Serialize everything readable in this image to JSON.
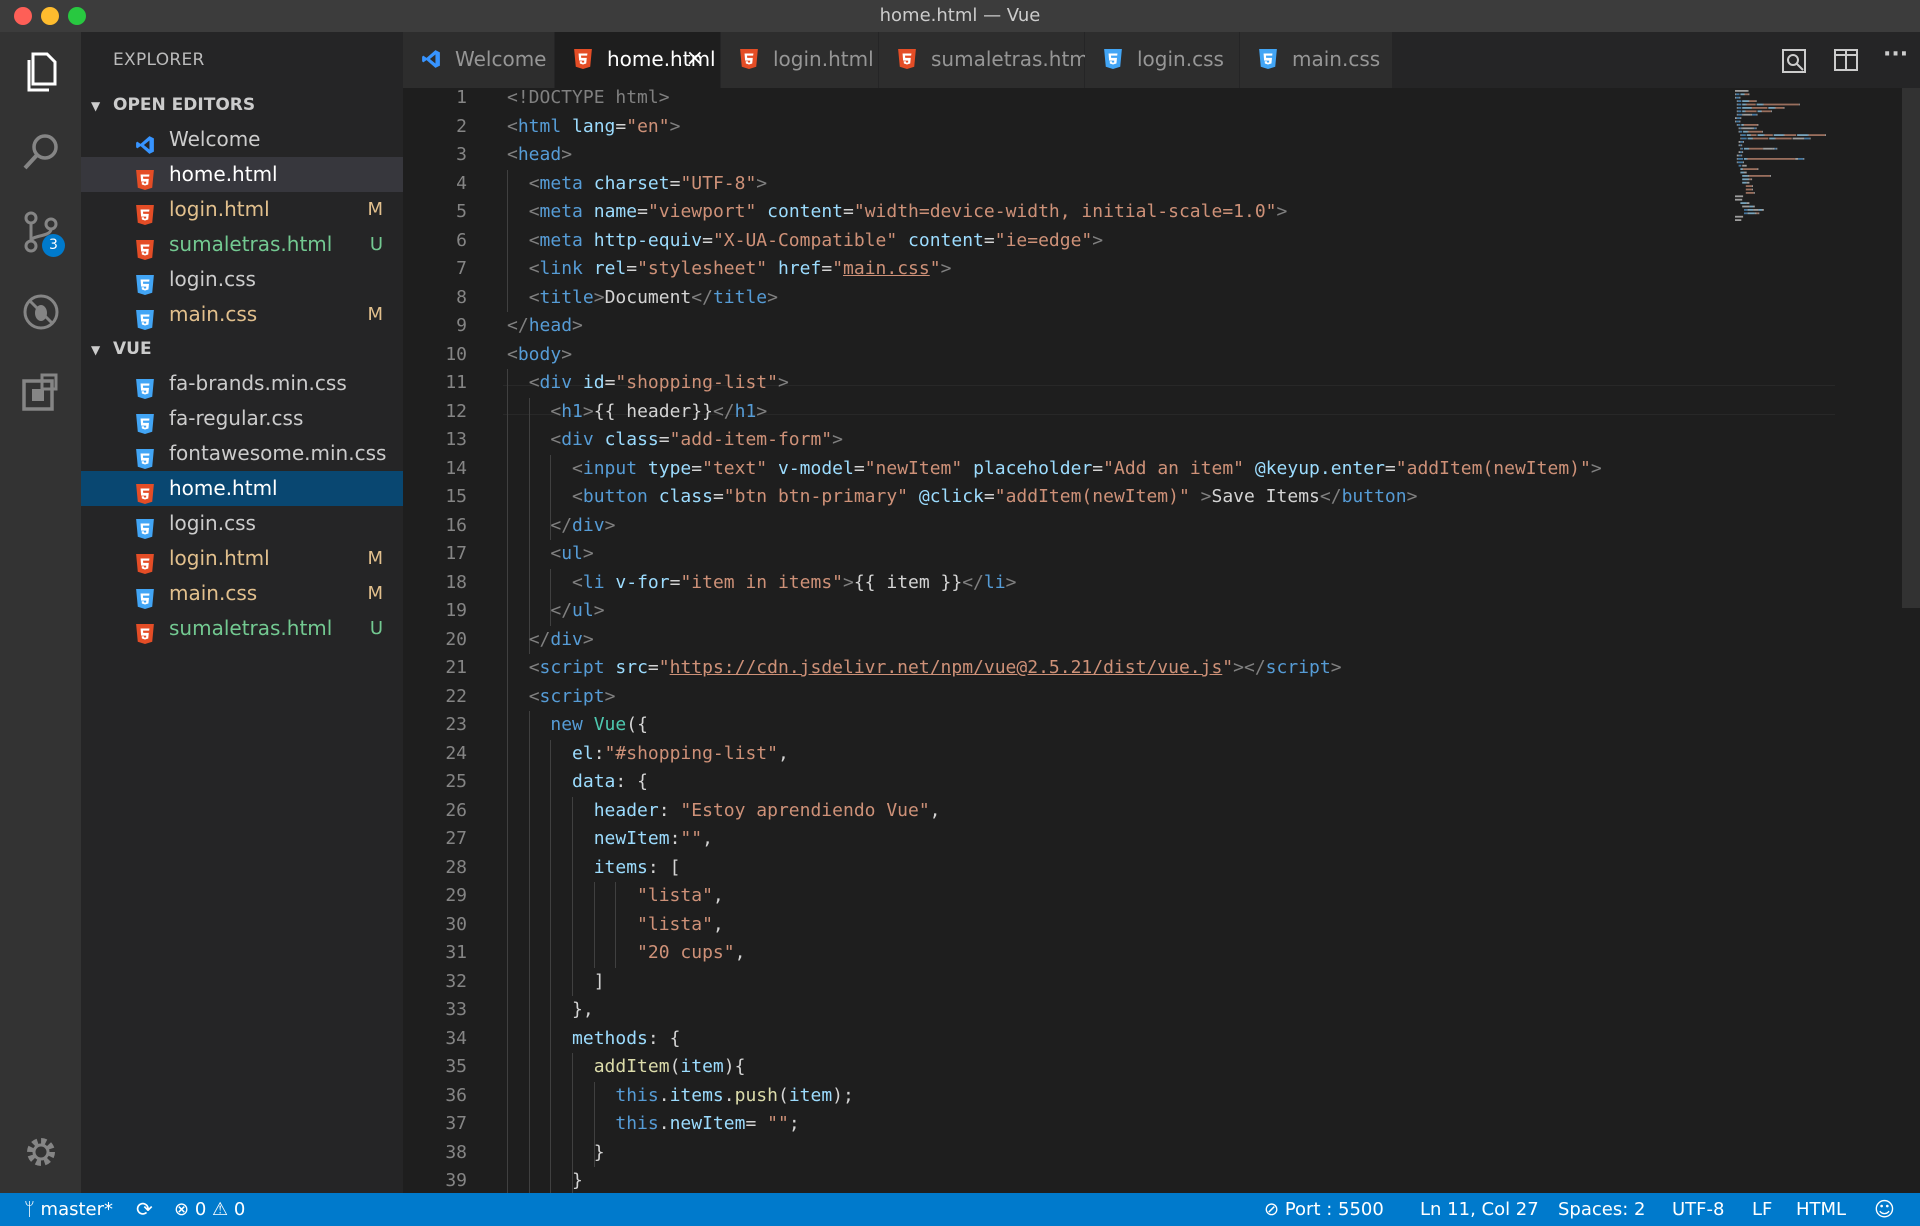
{
  "window": {
    "title": "home.html — Vue"
  },
  "activity": {
    "scm_badge": "3"
  },
  "sidebar": {
    "title": "EXPLORER",
    "open_editors_title": "OPEN EDITORS",
    "open_editors": [
      {
        "name": "Welcome",
        "type": "vscode",
        "status": "",
        "color": "#cccccc"
      },
      {
        "name": "home.html",
        "type": "html",
        "status": "",
        "color": "#ffffff"
      },
      {
        "name": "login.html",
        "type": "html",
        "status": "M",
        "color": "#e2c08d"
      },
      {
        "name": "sumaletras.html",
        "type": "html",
        "status": "U",
        "color": "#73c991"
      },
      {
        "name": "login.css",
        "type": "css",
        "status": "",
        "color": "#cccccc"
      },
      {
        "name": "main.css",
        "type": "css",
        "status": "M",
        "color": "#e2c08d"
      }
    ],
    "folder_title": "VUE",
    "files": [
      {
        "name": "fa-brands.min.css",
        "type": "css",
        "status": "",
        "color": "#cccccc"
      },
      {
        "name": "fa-regular.css",
        "type": "css",
        "status": "",
        "color": "#cccccc"
      },
      {
        "name": "fontawesome.min.css",
        "type": "css",
        "status": "",
        "color": "#cccccc"
      },
      {
        "name": "home.html",
        "type": "html",
        "status": "",
        "color": "#ffffff"
      },
      {
        "name": "login.css",
        "type": "css",
        "status": "",
        "color": "#cccccc"
      },
      {
        "name": "login.html",
        "type": "html",
        "status": "M",
        "color": "#e2c08d"
      },
      {
        "name": "main.css",
        "type": "css",
        "status": "M",
        "color": "#e2c08d"
      },
      {
        "name": "sumaletras.html",
        "type": "html",
        "status": "U",
        "color": "#73c991"
      }
    ]
  },
  "tabs": [
    {
      "label": "Welcome",
      "type": "vscode"
    },
    {
      "label": "home.html",
      "type": "html"
    },
    {
      "label": "login.html",
      "type": "html"
    },
    {
      "label": "sumaletras.html",
      "type": "html"
    },
    {
      "label": "login.css",
      "type": "css"
    },
    {
      "label": "main.css",
      "type": "css"
    }
  ],
  "tab_close": "×",
  "editor": {
    "lines": [
      [
        [
          "p",
          "<!DOCTYPE html"
        ],
        [
          "p",
          ">"
        ]
      ],
      [
        [
          "p",
          "<"
        ],
        [
          "t",
          "html"
        ],
        [
          "x",
          " "
        ],
        [
          "a",
          "lang"
        ],
        [
          "x",
          "="
        ],
        [
          "s",
          "\"en\""
        ],
        [
          "p",
          ">"
        ]
      ],
      [
        [
          "p",
          "<"
        ],
        [
          "t",
          "head"
        ],
        [
          "p",
          ">"
        ]
      ],
      [
        [
          "x",
          "  "
        ],
        [
          "p",
          "<"
        ],
        [
          "t",
          "meta"
        ],
        [
          "x",
          " "
        ],
        [
          "a",
          "charset"
        ],
        [
          "x",
          "="
        ],
        [
          "s",
          "\"UTF-8\""
        ],
        [
          "p",
          ">"
        ]
      ],
      [
        [
          "x",
          "  "
        ],
        [
          "p",
          "<"
        ],
        [
          "t",
          "meta"
        ],
        [
          "x",
          " "
        ],
        [
          "a",
          "name"
        ],
        [
          "x",
          "="
        ],
        [
          "s",
          "\"viewport\""
        ],
        [
          "x",
          " "
        ],
        [
          "a",
          "content"
        ],
        [
          "x",
          "="
        ],
        [
          "s",
          "\"width=device-width, initial-scale=1.0\""
        ],
        [
          "p",
          ">"
        ]
      ],
      [
        [
          "x",
          "  "
        ],
        [
          "p",
          "<"
        ],
        [
          "t",
          "meta"
        ],
        [
          "x",
          " "
        ],
        [
          "a",
          "http-equiv"
        ],
        [
          "x",
          "="
        ],
        [
          "s",
          "\"X-UA-Compatible\""
        ],
        [
          "x",
          " "
        ],
        [
          "a",
          "content"
        ],
        [
          "x",
          "="
        ],
        [
          "s",
          "\"ie=edge\""
        ],
        [
          "p",
          ">"
        ]
      ],
      [
        [
          "x",
          "  "
        ],
        [
          "p",
          "<"
        ],
        [
          "t",
          "link"
        ],
        [
          "x",
          " "
        ],
        [
          "a",
          "rel"
        ],
        [
          "x",
          "="
        ],
        [
          "s",
          "\"stylesheet\""
        ],
        [
          "x",
          " "
        ],
        [
          "a",
          "href"
        ],
        [
          "x",
          "="
        ],
        [
          "s",
          "\""
        ],
        [
          "su",
          "main.css"
        ],
        [
          "s",
          "\""
        ],
        [
          "p",
          ">"
        ]
      ],
      [
        [
          "x",
          "  "
        ],
        [
          "p",
          "<"
        ],
        [
          "t",
          "title"
        ],
        [
          "p",
          ">"
        ],
        [
          "x",
          "Document"
        ],
        [
          "p",
          "</"
        ],
        [
          "t",
          "title"
        ],
        [
          "p",
          ">"
        ]
      ],
      [
        [
          "p",
          "</"
        ],
        [
          "t",
          "head"
        ],
        [
          "p",
          ">"
        ]
      ],
      [
        [
          "p",
          "<"
        ],
        [
          "t",
          "body"
        ],
        [
          "p",
          ">"
        ]
      ],
      [
        [
          "x",
          "  "
        ],
        [
          "p",
          "<"
        ],
        [
          "t",
          "div"
        ],
        [
          "x",
          " "
        ],
        [
          "a",
          "id"
        ],
        [
          "x",
          "="
        ],
        [
          "s",
          "\"shopping-list\""
        ],
        [
          "p",
          ">"
        ]
      ],
      [
        [
          "x",
          "    "
        ],
        [
          "p",
          "<"
        ],
        [
          "t",
          "h1"
        ],
        [
          "p",
          ">"
        ],
        [
          "x",
          "{{ header}}"
        ],
        [
          "p",
          "</"
        ],
        [
          "t",
          "h1"
        ],
        [
          "p",
          ">"
        ]
      ],
      [
        [
          "x",
          "    "
        ],
        [
          "p",
          "<"
        ],
        [
          "t",
          "div"
        ],
        [
          "x",
          " "
        ],
        [
          "a",
          "class"
        ],
        [
          "x",
          "="
        ],
        [
          "s",
          "\"add-item-form\""
        ],
        [
          "p",
          ">"
        ]
      ],
      [
        [
          "x",
          "      "
        ],
        [
          "p",
          "<"
        ],
        [
          "t",
          "input"
        ],
        [
          "x",
          " "
        ],
        [
          "a",
          "type"
        ],
        [
          "x",
          "="
        ],
        [
          "s",
          "\"text\""
        ],
        [
          "x",
          " "
        ],
        [
          "a",
          "v-model"
        ],
        [
          "x",
          "="
        ],
        [
          "s",
          "\"newItem\""
        ],
        [
          "x",
          " "
        ],
        [
          "a",
          "placeholder"
        ],
        [
          "x",
          "="
        ],
        [
          "s",
          "\"Add an item\""
        ],
        [
          "x",
          " "
        ],
        [
          "a",
          "@keyup.enter"
        ],
        [
          "x",
          "="
        ],
        [
          "s",
          "\"addItem(newItem)\""
        ],
        [
          "p",
          ">"
        ]
      ],
      [
        [
          "x",
          "      "
        ],
        [
          "p",
          "<"
        ],
        [
          "t",
          "button"
        ],
        [
          "x",
          " "
        ],
        [
          "a",
          "class"
        ],
        [
          "x",
          "="
        ],
        [
          "s",
          "\"btn btn-primary\""
        ],
        [
          "x",
          " "
        ],
        [
          "a",
          "@click"
        ],
        [
          "x",
          "="
        ],
        [
          "s",
          "\"addItem(newItem)\""
        ],
        [
          "x",
          " "
        ],
        [
          "p",
          ">"
        ],
        [
          "x",
          "Save Items"
        ],
        [
          "p",
          "</"
        ],
        [
          "t",
          "button"
        ],
        [
          "p",
          ">"
        ]
      ],
      [
        [
          "x",
          "    "
        ],
        [
          "p",
          "</"
        ],
        [
          "t",
          "div"
        ],
        [
          "p",
          ">"
        ]
      ],
      [
        [
          "x",
          "    "
        ],
        [
          "p",
          "<"
        ],
        [
          "t",
          "ul"
        ],
        [
          "p",
          ">"
        ]
      ],
      [
        [
          "x",
          "      "
        ],
        [
          "p",
          "<"
        ],
        [
          "t",
          "li"
        ],
        [
          "x",
          " "
        ],
        [
          "a",
          "v-for"
        ],
        [
          "x",
          "="
        ],
        [
          "s",
          "\"item in items\""
        ],
        [
          "p",
          ">"
        ],
        [
          "x",
          "{{ item }}"
        ],
        [
          "p",
          "</"
        ],
        [
          "t",
          "li"
        ],
        [
          "p",
          ">"
        ]
      ],
      [
        [
          "x",
          "    "
        ],
        [
          "p",
          "</"
        ],
        [
          "t",
          "ul"
        ],
        [
          "p",
          ">"
        ]
      ],
      [
        [
          "x",
          "  "
        ],
        [
          "p",
          "</"
        ],
        [
          "t",
          "div"
        ],
        [
          "p",
          ">"
        ]
      ],
      [
        [
          "x",
          "  "
        ],
        [
          "p",
          "<"
        ],
        [
          "t",
          "script"
        ],
        [
          "x",
          " "
        ],
        [
          "a",
          "src"
        ],
        [
          "x",
          "="
        ],
        [
          "s",
          "\""
        ],
        [
          "su",
          "https://cdn.jsdelivr.net/npm/vue@2.5.21/dist/vue.js"
        ],
        [
          "s",
          "\""
        ],
        [
          "p",
          "></"
        ],
        [
          "t",
          "script"
        ],
        [
          "p",
          ">"
        ]
      ],
      [
        [
          "x",
          "  "
        ],
        [
          "p",
          "<"
        ],
        [
          "t",
          "script"
        ],
        [
          "p",
          ">"
        ]
      ],
      [
        [
          "x",
          "    "
        ],
        [
          "k",
          "new"
        ],
        [
          "x",
          " "
        ],
        [
          "c",
          "Vue"
        ],
        [
          "x",
          "({"
        ]
      ],
      [
        [
          "x",
          "      "
        ],
        [
          "v",
          "el"
        ],
        [
          "x",
          ":"
        ],
        [
          "s",
          "\"#shopping-list\""
        ],
        [
          "x",
          ","
        ]
      ],
      [
        [
          "x",
          "      "
        ],
        [
          "v",
          "data"
        ],
        [
          "x",
          ": {"
        ]
      ],
      [
        [
          "x",
          "        "
        ],
        [
          "v",
          "header"
        ],
        [
          "x",
          ": "
        ],
        [
          "s",
          "\"Estoy aprendiendo Vue\""
        ],
        [
          "x",
          ","
        ]
      ],
      [
        [
          "x",
          "        "
        ],
        [
          "v",
          "newItem"
        ],
        [
          "x",
          ":"
        ],
        [
          "s",
          "\"\""
        ],
        [
          "x",
          ","
        ]
      ],
      [
        [
          "x",
          "        "
        ],
        [
          "v",
          "items"
        ],
        [
          "x",
          ": ["
        ]
      ],
      [
        [
          "x",
          "            "
        ],
        [
          "s",
          "\"lista\""
        ],
        [
          "x",
          ","
        ]
      ],
      [
        [
          "x",
          "            "
        ],
        [
          "s",
          "\"lista\""
        ],
        [
          "x",
          ","
        ]
      ],
      [
        [
          "x",
          "            "
        ],
        [
          "s",
          "\"20 cups\""
        ],
        [
          "x",
          ","
        ]
      ],
      [
        [
          "x",
          "        ]"
        ]
      ],
      [
        [
          "x",
          "      },"
        ]
      ],
      [
        [
          "x",
          "      "
        ],
        [
          "v",
          "methods"
        ],
        [
          "x",
          ": {"
        ]
      ],
      [
        [
          "x",
          "        "
        ],
        [
          "f",
          "addItem"
        ],
        [
          "x",
          "("
        ],
        [
          "v",
          "item"
        ],
        [
          "x",
          "){"
        ]
      ],
      [
        [
          "x",
          "          "
        ],
        [
          "k",
          "this"
        ],
        [
          "x",
          "."
        ],
        [
          "v",
          "items"
        ],
        [
          "x",
          "."
        ],
        [
          "f",
          "push"
        ],
        [
          "x",
          "("
        ],
        [
          "v",
          "item"
        ],
        [
          "x",
          ");"
        ]
      ],
      [
        [
          "x",
          "          "
        ],
        [
          "k",
          "this"
        ],
        [
          "x",
          "."
        ],
        [
          "v",
          "newItem"
        ],
        [
          "x",
          "= "
        ],
        [
          "s",
          "\"\""
        ],
        [
          "x",
          ";"
        ]
      ],
      [
        [
          "x",
          "        }"
        ]
      ],
      [
        [
          "x",
          "      }"
        ]
      ]
    ]
  },
  "status": {
    "branch": "master*",
    "errors": "0",
    "warnings": "0",
    "port": "Port : 5500",
    "position": "Ln 11, Col 27",
    "spaces": "Spaces: 2",
    "encoding": "UTF-8",
    "eol": "LF",
    "language": "HTML"
  },
  "colors": {
    "accent": "#007acc",
    "html_icon": "#e44d26",
    "css_icon": "#42a5f5",
    "modified": "#e2c08d",
    "untracked": "#73c991"
  }
}
